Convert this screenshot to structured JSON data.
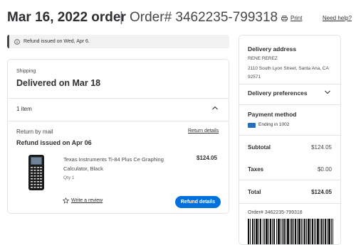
{
  "header": {
    "order_date": "Mar 16, 2022 order",
    "separator": "|",
    "order_number": "Order# 3462235-799318",
    "print_label": "Print",
    "help_label": "Need help?"
  },
  "alert": {
    "message": "Refund issued on Wed, Apr 6."
  },
  "shipment": {
    "label": "Shipping",
    "status": "Delivered on Mar 18",
    "item_count": "1 item",
    "return_method": "Return by mail",
    "return_details_label": "Return details",
    "refund_status": "Refund issued on Apr 06",
    "product": {
      "name": "Texas Instruments Ti-84 Plus Ce Graphing Calculator, Black",
      "qty": "Qty 1",
      "price": "$124.05"
    },
    "write_review_label": "Write a review",
    "refund_button_label": "Refund details"
  },
  "sidebar": {
    "delivery_address_title": "Delivery address",
    "name": "RENE REREZ",
    "address_line": "2110 South Lyon Street, Santa Ana, CA 92571",
    "delivery_preferences_label": "Delivery preferences",
    "payment_method_title": "Payment method",
    "card_ending": "Ending in 1002",
    "subtotal_label": "Subtotal",
    "subtotal_value": "$124.05",
    "taxes_label": "Taxes",
    "taxes_value": "$0.00",
    "total_label": "Total",
    "total_value": "$124.05",
    "order_number": "Order# 3462235-799318"
  },
  "colors": {
    "accent_blue": "#0071dc",
    "text_dark": "#2e2f32",
    "border": "#e3e4e5",
    "alert_bg": "#f2f2f2"
  }
}
